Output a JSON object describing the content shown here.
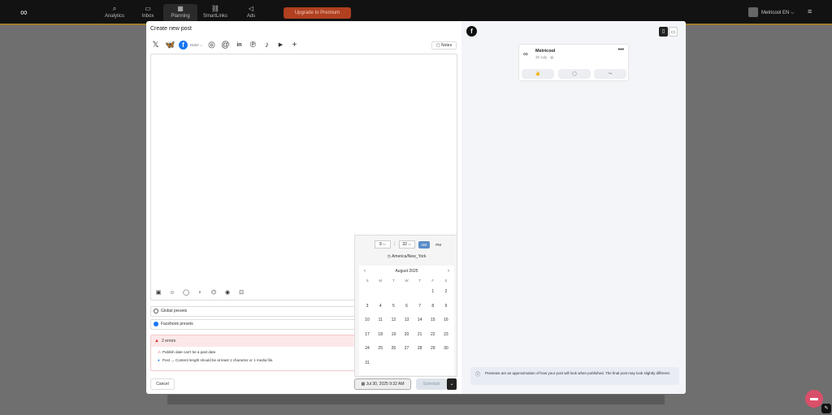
{
  "topbar": {
    "logo": "∞",
    "nav": [
      {
        "label": "Analytics",
        "icon": "⌕"
      },
      {
        "label": "Inbox",
        "icon": "▭"
      },
      {
        "label": "Planning",
        "icon": "▦"
      },
      {
        "label": "SmartLinks",
        "icon": "⛓"
      },
      {
        "label": "Ads",
        "icon": "◁"
      }
    ],
    "upgrade_label": "Upgrade to Premium",
    "account_label": "Metricool EN ⌵",
    "menu_icon": "≡"
  },
  "modal": {
    "title": "Create new post",
    "networks": [
      {
        "name": "x",
        "glyph": "𝕏"
      },
      {
        "name": "bluesky",
        "glyph": "🦋"
      },
      {
        "name": "facebook",
        "glyph": "f"
      },
      {
        "name": "instagram",
        "glyph": "◎"
      },
      {
        "name": "threads",
        "glyph": "@"
      },
      {
        "name": "linkedin",
        "glyph": "in"
      },
      {
        "name": "pinterest",
        "glyph": "℗"
      },
      {
        "name": "tiktok",
        "glyph": "♪"
      },
      {
        "name": "youtube",
        "glyph": "▶"
      },
      {
        "name": "add",
        "glyph": "+"
      }
    ],
    "post_type": "POST ⌵",
    "notes_label": "Notes",
    "toolbar_icons": [
      "▣",
      "☺",
      "◯",
      "♀",
      "⌬",
      "◉",
      "⊡"
    ],
    "presets": [
      {
        "label": "Global presets",
        "color": "#555555"
      },
      {
        "label": "Facebook presets",
        "color": "#1877f2"
      }
    ],
    "errors": {
      "title": "2 errors",
      "items": [
        "Publish date can't be a past date.",
        "Post → Content length should be at least 1 character or 1 media file."
      ]
    },
    "cancel_label": "Cancel",
    "date_label": "Jul 30, 2025 9:32 AM",
    "schedule_label": "Schedule",
    "schedule_arrow": "⌄"
  },
  "picker": {
    "hour": "9 ⌵",
    "minute": "32 ⌵",
    "separator": ":",
    "am": "AM",
    "pm": "PM",
    "timezone": "America/New_York",
    "month": "August 2025",
    "weekdays": [
      "S",
      "M",
      "T",
      "W",
      "T",
      "F",
      "S"
    ],
    "days": [
      "",
      "",
      "",
      "",
      "",
      "1",
      "2",
      "3",
      "4",
      "5",
      "6",
      "7",
      "8",
      "9",
      "10",
      "11",
      "12",
      "13",
      "14",
      "15",
      "16",
      "17",
      "18",
      "19",
      "20",
      "21",
      "22",
      "23",
      "24",
      "25",
      "26",
      "27",
      "28",
      "29",
      "30",
      "31"
    ]
  },
  "preview": {
    "account_name": "Metricool",
    "date": "30 July · ◍",
    "actions": [
      "👍",
      "◯",
      "↪"
    ],
    "disclaimer": "Previews are an approximation of how your post will look when published. The final post may look slightly different."
  },
  "colors": {
    "accent": "#5b8dc9",
    "error": "#d33333",
    "facebook": "#1877f2"
  }
}
